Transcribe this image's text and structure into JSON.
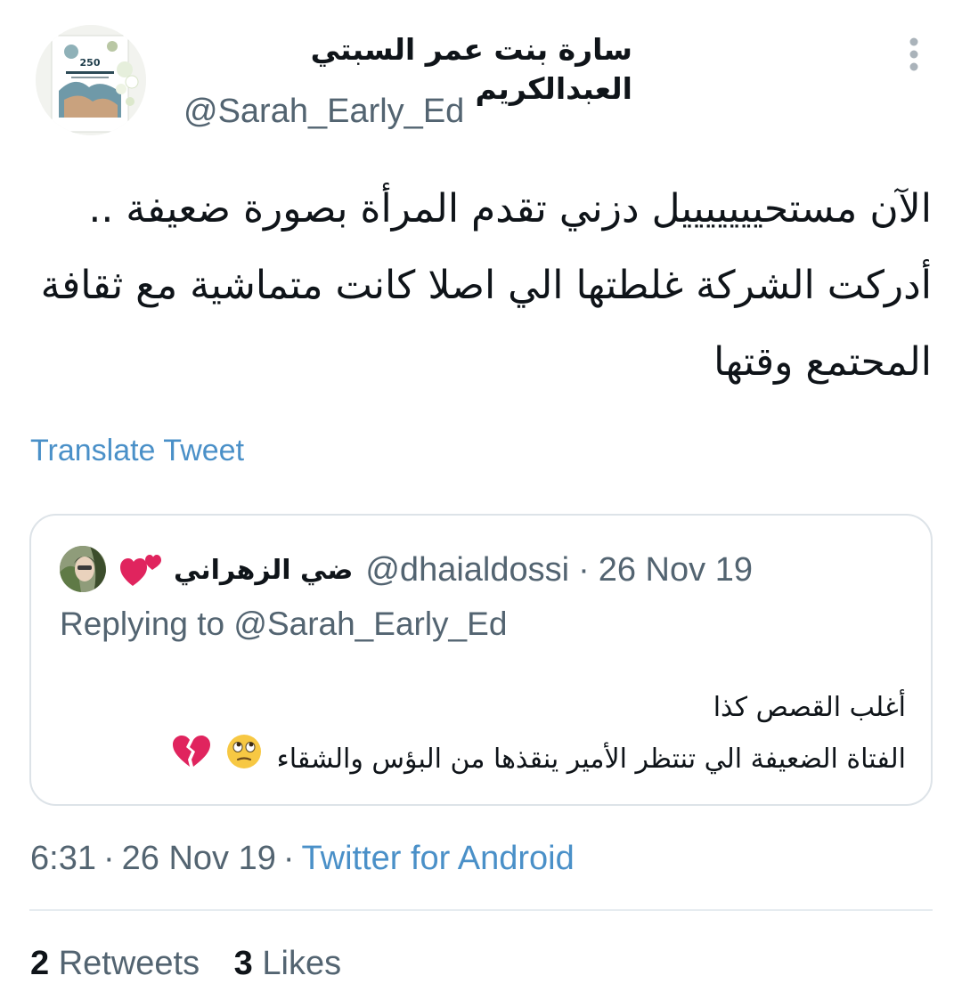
{
  "author": {
    "display_name": "سارة بنت عمر السبتي العبدالكريم",
    "handle": "@Sarah_Early_Ed",
    "avatar_icon": "book-cover-avatar",
    "avatar_cover_number": "250"
  },
  "tweet": {
    "text": "الآن مستحيييييييل دزني تقدم المرأة بصورة ضعيفة .. أدركت الشركة غلطتها الي اصلا كانت متماشية مع ثقافة المحتمع وقتها",
    "translate_label": "Translate Tweet"
  },
  "quoted_tweet": {
    "display_name": "ضي الزهراني",
    "name_emoji": "two-hearts-icon",
    "handle": "@dhaialdossi",
    "date": "26 Nov 19",
    "replying_prefix": "Replying to",
    "replying_to": "@Sarah_Early_Ed",
    "line1": "أغلب القصص كذا",
    "line2": "الفتاة الضعيفة الي تنتظر الأمير ينقذها من البؤس والشقاء",
    "line2_emojis": [
      "face-with-rolling-eyes-icon",
      "broken-heart-icon"
    ]
  },
  "meta": {
    "time": "6:31",
    "date": "26 Nov 19",
    "source": "Twitter for Android",
    "separator": "·"
  },
  "stats": {
    "retweets_count": "2",
    "retweets_label": "Retweets",
    "likes_count": "3",
    "likes_label": "Likes"
  },
  "colors": {
    "text_primary": "#0f1419",
    "text_secondary": "#536471",
    "link": "#4a90c8",
    "border": "#dde3e8",
    "heart": "#e0245e"
  }
}
